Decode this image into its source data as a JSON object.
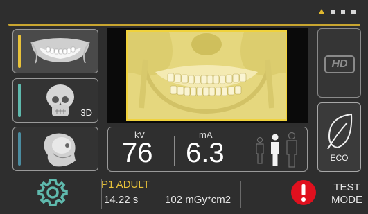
{
  "page_dots": [
    {
      "active": true
    },
    {
      "active": false
    },
    {
      "active": false
    },
    {
      "active": false
    }
  ],
  "modes": [
    {
      "name": "panoramic",
      "selected": true,
      "stripe_color": "#e8c23a"
    },
    {
      "name": "3d",
      "label": "3D",
      "selected": false,
      "stripe_color": "#5fb9ad"
    },
    {
      "name": "cephalometric",
      "selected": false,
      "stripe_color": "#4b8ca0"
    }
  ],
  "exposure": {
    "kv_unit": "kV",
    "kv_value": "76",
    "ma_unit": "mA",
    "ma_value": "6.3"
  },
  "side_buttons": {
    "hd_label": "HD",
    "eco_label": "ECO"
  },
  "status": {
    "profile": "P1 ADULT",
    "time": "14.22 s",
    "dap": "102 mGy*cm2"
  },
  "test_mode": {
    "line1": "TEST",
    "line2": "MODE"
  },
  "colors": {
    "accent": "#e8c23a",
    "warning": "#e0101e",
    "xray_tint": "#e8da82"
  }
}
